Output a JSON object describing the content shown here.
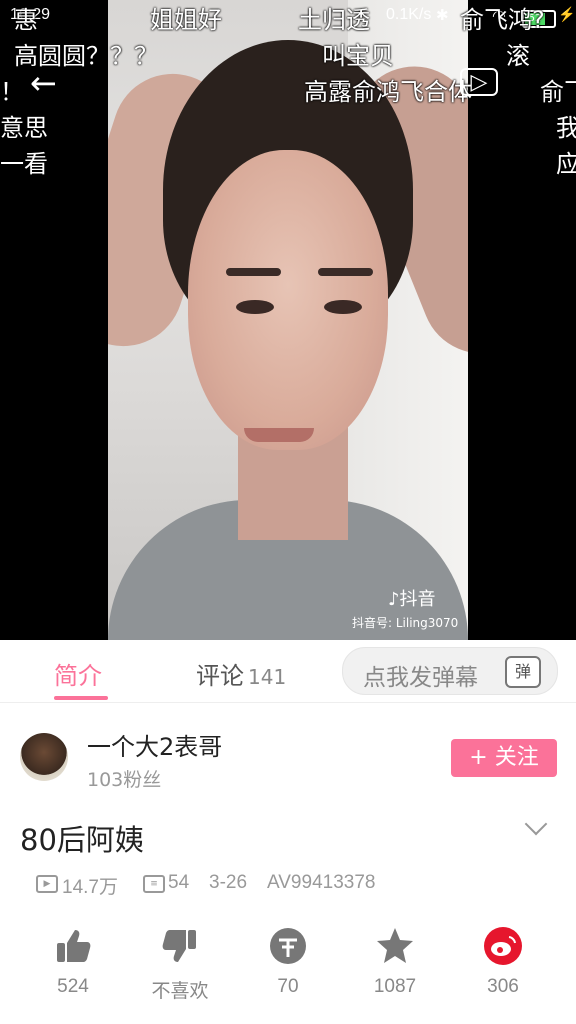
{
  "status_bar": {
    "time": "16:29",
    "speed": "0.1K/s",
    "battery": "52"
  },
  "danmaku": [
    {
      "text": "惠",
      "id": "d1"
    },
    {
      "text": "姐姐好",
      "id": "d2"
    },
    {
      "text": "土归透",
      "id": "d3"
    },
    {
      "text": "俞飞鸿?",
      "id": "d4"
    },
    {
      "text": "高圆圆？？？",
      "id": "d5"
    },
    {
      "text": "叫宝贝",
      "id": "d6"
    },
    {
      "text": "滚",
      "id": "d7"
    },
    {
      "text": "！",
      "id": "d8"
    },
    {
      "text": "高露俞鸿飞合体",
      "id": "d9"
    },
    {
      "text": "俞飞",
      "id": "d10"
    },
    {
      "text": "意思",
      "id": "d11"
    },
    {
      "text": "我",
      "id": "d12"
    },
    {
      "text": "一看",
      "id": "d13"
    },
    {
      "text": "应",
      "id": "d14"
    }
  ],
  "video": {
    "watermark": "抖音",
    "watermark_id": "抖音号: Liling3070"
  },
  "tabs": {
    "intro": "简介",
    "comments": "评论",
    "comments_count": "141",
    "danmaku_placeholder": "点我发弹幕",
    "danmaku_icon": "弹"
  },
  "uploader": {
    "name": "一个大2表哥",
    "fans": "103粉丝",
    "follow": "+ 关注"
  },
  "video_info": {
    "title": "80后阿姨",
    "plays": "14.7万",
    "danmaku_count": "54",
    "date": "3-26",
    "av": "AV99413378"
  },
  "actions": {
    "like": "524",
    "dislike": "不喜欢",
    "coin": "70",
    "favorite": "1087",
    "share": "306"
  },
  "colors": {
    "accent": "#fb7299",
    "weibo": "#e6162d"
  }
}
